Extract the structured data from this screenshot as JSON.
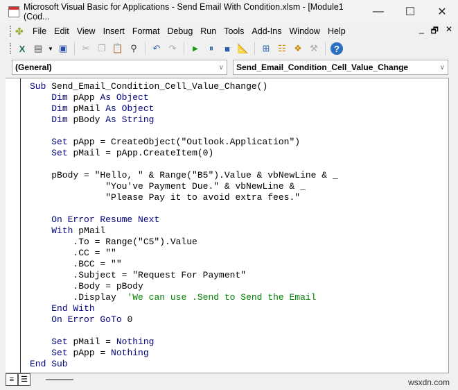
{
  "window": {
    "title": "Microsoft Visual Basic for Applications - Send Email With Condition.xlsm - [Module1 (Cod...",
    "minimize": "—",
    "maximize": "☐",
    "close": "✕"
  },
  "menu": {
    "items": [
      "File",
      "Edit",
      "View",
      "Insert",
      "Format",
      "Debug",
      "Run",
      "Tools",
      "Add-Ins",
      "Window",
      "Help"
    ],
    "mdi": [
      "_",
      "🗗",
      "✕"
    ]
  },
  "toolbar": {
    "icons": [
      "excel-icon",
      "insert-userform-icon",
      "dropdown-icon",
      "save-icon",
      "cut-icon",
      "copy-icon",
      "paste-icon",
      "find-icon",
      "undo-icon",
      "redo-icon",
      "run-icon",
      "break-icon",
      "reset-icon",
      "design-mode-icon",
      "project-explorer-icon",
      "properties-icon",
      "object-browser-icon",
      "toolbox-icon",
      "help-icon"
    ]
  },
  "combos": {
    "object": "(General)",
    "procedure": "Send_Email_Condition_Cell_Value_Change"
  },
  "code": [
    [
      [
        "kw",
        "Sub "
      ],
      [
        "tx",
        "Send_Email_Condition_Cell_Value_Change()"
      ]
    ],
    [
      [
        "tx",
        "    "
      ],
      [
        "kw",
        "Dim "
      ],
      [
        "tx",
        "pApp "
      ],
      [
        "kw",
        "As Object"
      ]
    ],
    [
      [
        "tx",
        "    "
      ],
      [
        "kw",
        "Dim "
      ],
      [
        "tx",
        "pMail "
      ],
      [
        "kw",
        "As Object"
      ]
    ],
    [
      [
        "tx",
        "    "
      ],
      [
        "kw",
        "Dim "
      ],
      [
        "tx",
        "pBody "
      ],
      [
        "kw",
        "As String"
      ]
    ],
    [],
    [
      [
        "tx",
        "    "
      ],
      [
        "kw",
        "Set "
      ],
      [
        "tx",
        "pApp = CreateObject(\"Outlook.Application\")"
      ]
    ],
    [
      [
        "tx",
        "    "
      ],
      [
        "kw",
        "Set "
      ],
      [
        "tx",
        "pMail = pApp.CreateItem(0)"
      ]
    ],
    [],
    [
      [
        "tx",
        "    pBody = \"Hello, \" & Range(\"B5\").Value & vbNewLine & _"
      ]
    ],
    [
      [
        "tx",
        "              \"You've Payment Due.\" & vbNewLine & _"
      ]
    ],
    [
      [
        "tx",
        "              \"Please Pay it to avoid extra fees.\""
      ]
    ],
    [],
    [
      [
        "tx",
        "    "
      ],
      [
        "kw",
        "On Error Resume Next"
      ]
    ],
    [
      [
        "tx",
        "    "
      ],
      [
        "kw",
        "With "
      ],
      [
        "tx",
        "pMail"
      ]
    ],
    [
      [
        "tx",
        "        .To = Range(\"C5\").Value"
      ]
    ],
    [
      [
        "tx",
        "        .CC = \"\""
      ]
    ],
    [
      [
        "tx",
        "        .BCC = \"\""
      ]
    ],
    [
      [
        "tx",
        "        .Subject = \"Request For Payment\""
      ]
    ],
    [
      [
        "tx",
        "        .Body = pBody"
      ]
    ],
    [
      [
        "tx",
        "        .Display  "
      ],
      [
        "cm",
        "'We can use .Send to Send the Email"
      ]
    ],
    [
      [
        "tx",
        "    "
      ],
      [
        "kw",
        "End With"
      ]
    ],
    [
      [
        "tx",
        "    "
      ],
      [
        "kw",
        "On Error GoTo "
      ],
      [
        "tx",
        "0"
      ]
    ],
    [],
    [
      [
        "tx",
        "    "
      ],
      [
        "kw",
        "Set "
      ],
      [
        "tx",
        "pMail = "
      ],
      [
        "kw",
        "Nothing"
      ]
    ],
    [
      [
        "tx",
        "    "
      ],
      [
        "kw",
        "Set "
      ],
      [
        "tx",
        "pApp = "
      ],
      [
        "kw",
        "Nothing"
      ]
    ],
    [
      [
        "kw",
        "End Sub"
      ]
    ]
  ],
  "bottom": {
    "procedure_view": "≡",
    "module_view": "☰"
  },
  "watermark": "wsxdn.com"
}
